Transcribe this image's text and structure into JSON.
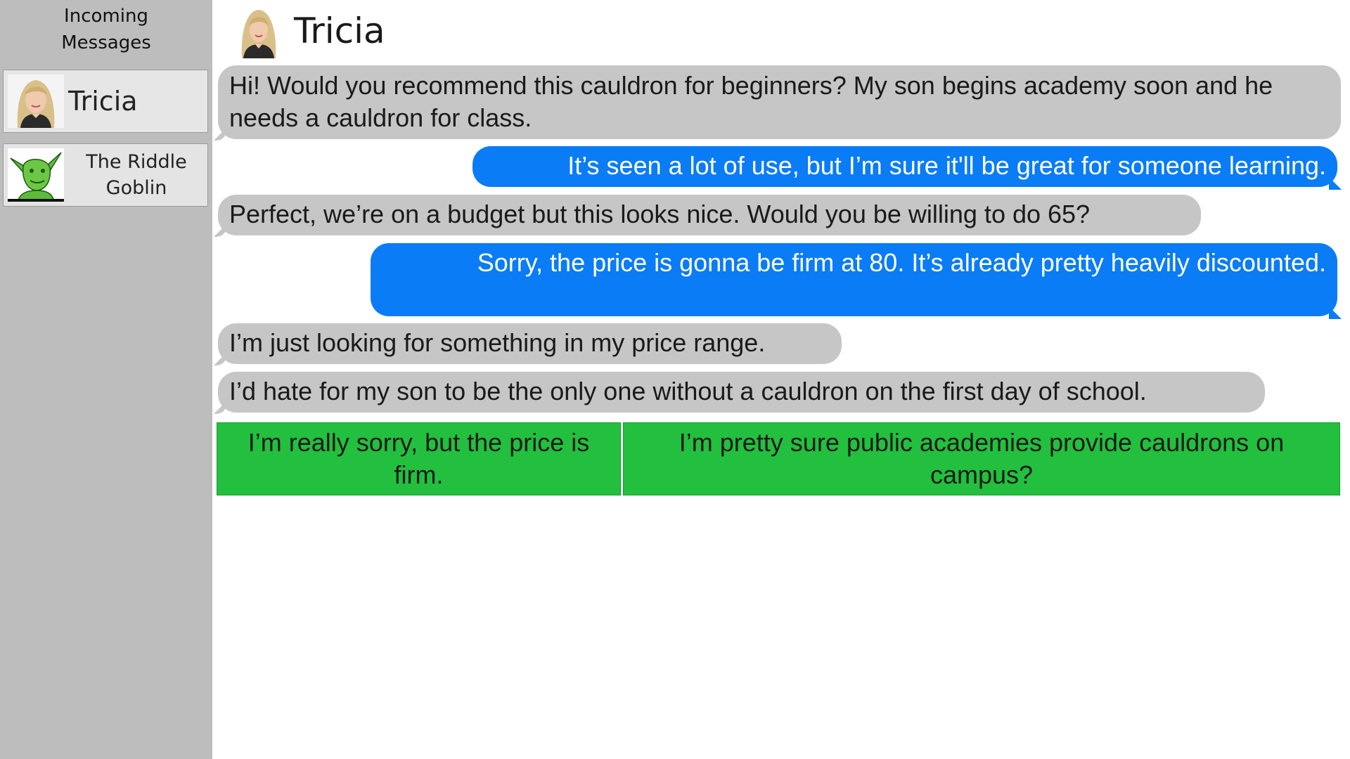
{
  "sidebar": {
    "title": "Incoming\nMessages",
    "contacts": [
      {
        "name": "Tricia",
        "avatar": "woman-portrait",
        "active": true
      },
      {
        "name": "The Riddle\nGoblin",
        "avatar": "green-goblin-portrait",
        "active": false
      }
    ]
  },
  "chat": {
    "contact_name": "Tricia",
    "messages": [
      {
        "from": "them",
        "text": "Hi! Would you recommend this cauldron for beginners? My son begins academy soon and he needs a cauldron for class."
      },
      {
        "from": "me",
        "text": "It’s seen a lot of use, but I’m sure it'll be great for someone learning."
      },
      {
        "from": "them",
        "text": "Perfect, we’re on a budget but this looks nice. Would you be willing to do 65?"
      },
      {
        "from": "me",
        "text": "Sorry, the price is gonna be firm at 80. It’s already pretty heavily discounted."
      },
      {
        "from": "them",
        "text": "I’m just looking for something in my price range."
      },
      {
        "from": "them",
        "text": "I’d hate for my son to be the only one without a cauldron on the first day of school."
      }
    ],
    "reply_options": [
      "I’m really sorry, but the price is firm.",
      "I’m pretty sure public academies provide cauldrons on campus?"
    ]
  },
  "colors": {
    "sidebar_bg": "#bdbdbd",
    "incoming_bubble": "#c6c6c6",
    "outgoing_bubble": "#0a7cf5",
    "reply_option": "#22c03e"
  }
}
